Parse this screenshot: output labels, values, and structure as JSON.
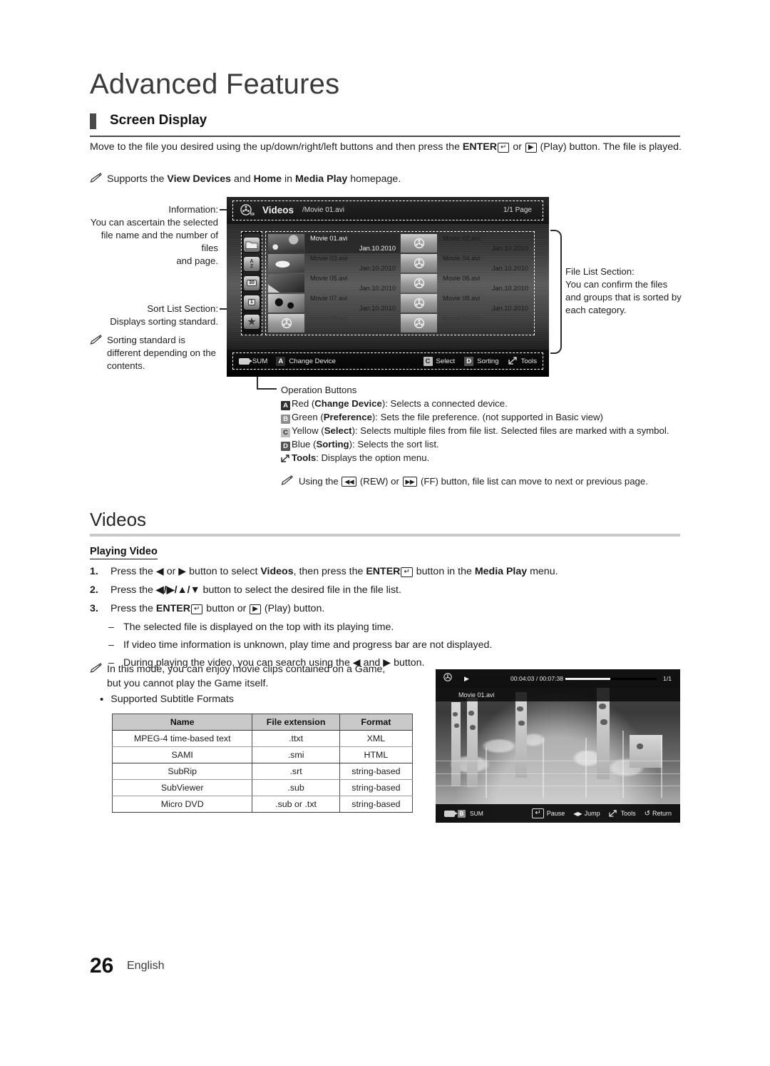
{
  "chapter": {
    "title": "Advanced Features"
  },
  "section": {
    "heading": "Screen Display"
  },
  "intro": {
    "part1": "Move to the file you desired using the up/down/right/left buttons and then press the ",
    "enter_label": "ENTER",
    "enter_glyph": "↵",
    "part2": " or ",
    "play_glyph": "▶",
    "part3": " (Play) button. The file is played.",
    "note_part1": "Supports the ",
    "note_bold1": "View Devices",
    "note_part2": " and ",
    "note_bold2": "Home",
    "note_part3": " in ",
    "note_bold3": "Media Play",
    "note_part4": " homepage."
  },
  "callouts": {
    "information": {
      "label": "Information:",
      "line1": "You can ascertain the selected",
      "line2": "file name and the number of files",
      "line3": "and page."
    },
    "sort_list": {
      "label": "Sort List Section:",
      "line1": "Displays sorting standard."
    },
    "sorting_note": {
      "line1": "Sorting standard is",
      "line2": "different depending on the",
      "line3": "contents."
    },
    "file_list": {
      "label": "File List Section:",
      "line1": "You can confirm the files",
      "line2": "and groups that is sorted by",
      "line3": "each category."
    }
  },
  "tv": {
    "title": "Videos",
    "path": "/Movie 01.avi",
    "page": "1/1 Page",
    "sort_icons": [
      "folder-icon",
      "a-z-icon",
      "calendar-30-icon",
      "calendar-1-icon",
      "star-icon"
    ],
    "sort_icon_labels": [
      "",
      "A–Z",
      "30",
      "1",
      "★"
    ],
    "files": [
      {
        "name": "Movie 01.avi",
        "date": "Jan.10.2010",
        "thumb": "t1",
        "selected": true,
        "dim": false
      },
      {
        "name": "Movie 02.avi",
        "date": "Jan.10.2010",
        "thumb": "reel",
        "selected": false,
        "dim": false
      },
      {
        "name": "Movie 03.avi",
        "date": "Jan.10.2010",
        "thumb": "t3",
        "selected": false,
        "dim": false
      },
      {
        "name": "Movie 04.avi",
        "date": "Jan.10.2010",
        "thumb": "reel",
        "selected": false,
        "dim": false
      },
      {
        "name": "Movie 05.avi",
        "date": "Jan.10.2010",
        "thumb": "t5",
        "selected": false,
        "dim": false
      },
      {
        "name": "Movie 06.avi",
        "date": "Jan.10.2010",
        "thumb": "reel",
        "selected": false,
        "dim": false
      },
      {
        "name": "Movie 07.avi",
        "date": "Jan.10.2010",
        "thumb": "t7",
        "selected": false,
        "dim": false
      },
      {
        "name": "Movie 08.avi",
        "date": "Jan.10.2010",
        "thumb": "reel",
        "selected": false,
        "dim": false
      },
      {
        "name": "Movie 09.avi",
        "date": "Jan.10.2010",
        "thumb": "reel",
        "selected": false,
        "dim": true
      },
      {
        "name": "Movie 10.avi",
        "date": "Jan.10.2010",
        "thumb": "reel",
        "selected": false,
        "dim": true
      }
    ],
    "bottom_bar": {
      "sum": "SUM",
      "a_key": "A",
      "change_device": "Change Device",
      "c_key": "C",
      "select": "Select",
      "d_key": "D",
      "sorting": "Sorting",
      "tools": "Tools"
    }
  },
  "operation": {
    "title": "Operation Buttons",
    "rows": [
      {
        "key": "A",
        "color": "Red",
        "bold": "Change Device",
        "rest": "): Selects a connected device."
      },
      {
        "key": "B",
        "color": "Green",
        "bold": "Preference",
        "rest": "): Sets the file preference. (not supported in Basic view)"
      },
      {
        "key": "C",
        "color": "Yellow",
        "bold": "Select",
        "rest": "): Selects multiple files from file list. Selected files are marked with a symbol."
      },
      {
        "key": "D",
        "color": "Blue",
        "bold": "Sorting",
        "rest": "): Selects the sort list."
      }
    ],
    "tools_bold": "Tools",
    "tools_rest": ": Displays the option menu.",
    "note_part1": "Using the ",
    "note_rew": "◀◀",
    "note_part2": " (REW) or ",
    "note_ff": "▶▶",
    "note_part3": " (FF) button, file list can move to next or previous page."
  },
  "videos_section": {
    "heading": "Videos",
    "sub_heading": "Playing Video",
    "steps": [
      {
        "num": "1.",
        "html_id": "step1"
      },
      {
        "num": "2.",
        "html_id": "step2"
      },
      {
        "num": "3.",
        "html_id": "step3"
      }
    ],
    "step1_a": "Press the ",
    "step1_b": "◀",
    "step1_c": " or ",
    "step1_d": "▶",
    "step1_e": " button to select ",
    "step1_bold1": "Videos",
    "step1_f": ", then press the ",
    "step1_enter": "ENTER",
    "step1_g": " button in the ",
    "step1_bold2": "Media Play",
    "step1_h": " menu.",
    "step2_a": "Press the ",
    "step2_keys": "◀/▶/▲/▼",
    "step2_b": " button to select the desired file in the file list.",
    "step3_a": "Press the ",
    "step3_enter": "ENTER",
    "step3_b": " button or ",
    "step3_play": "▶",
    "step3_c": " (Play) button.",
    "dashes": [
      "The selected file is displayed on the top with its playing time.",
      "If video time information is unknown, play time and progress bar are not displayed.",
      "During playing the video, you can search using the ◀ and ▶ button."
    ],
    "note_line1": "In this mode, you can enjoy movie clips contained on a Game,",
    "note_line2": "but you cannot play the Game itself.",
    "bullet": "Supported Subtitle Formats"
  },
  "subtitle_table": {
    "headers": [
      "Name",
      "File extension",
      "Format"
    ],
    "rows": [
      [
        "MPEG-4 time-based text",
        ".ttxt",
        "XML"
      ],
      [
        "SAMI",
        ".smi",
        "HTML"
      ],
      [
        "SubRip",
        ".srt",
        "string-based"
      ],
      [
        "SubViewer",
        ".sub",
        "string-based"
      ],
      [
        "Micro DVD",
        ".sub or .txt",
        "string-based"
      ]
    ]
  },
  "player": {
    "time": "00:04:03 / 00:07:38",
    "page": "1/1",
    "filename": "Movie 01.avi",
    "progress_percent": 49,
    "bottom": {
      "sum": "SUM",
      "b_key": "B",
      "pause": "Pause",
      "jump": "Jump",
      "tools": "Tools",
      "return": "Return"
    }
  },
  "footer": {
    "page_number": "26",
    "language": "English"
  },
  "colors": {
    "accent": "#4a4a4a",
    "rule": "#c8c8c8",
    "table_header": "#c9c9c9"
  }
}
